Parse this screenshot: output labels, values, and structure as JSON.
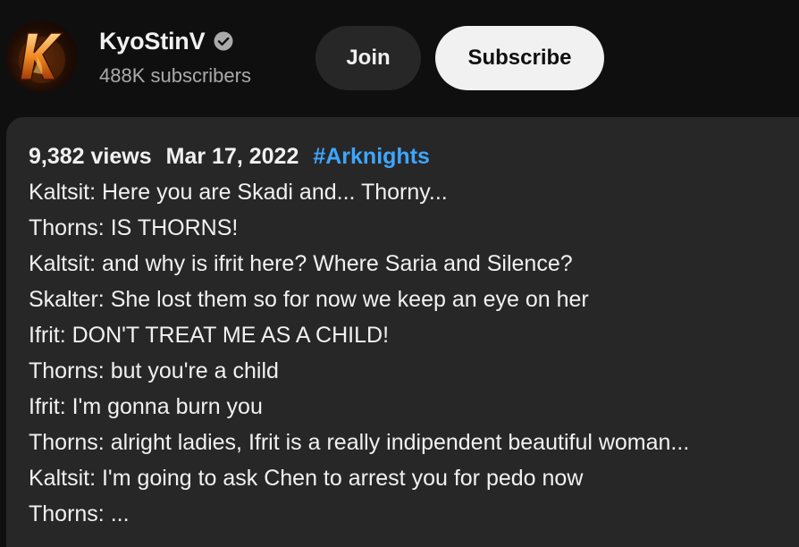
{
  "channel": {
    "avatar_icon": "k-flame-logo-icon",
    "name": "KyoStinV",
    "verified_icon": "verified-check-icon",
    "subscribers": "488K subscribers"
  },
  "buttons": {
    "join_label": "Join",
    "subscribe_label": "Subscribe"
  },
  "description": {
    "views": "9,382 views",
    "date": "Mar 17, 2022",
    "hashtag": "#Arknights",
    "lines": [
      "Kaltsit: Here you are Skadi and... Thorny...",
      "Thorns: IS THORNS!",
      "Kaltsit: and why is ifrit here? Where Saria and Silence?",
      "Skalter: She lost them so for now we keep an eye on her",
      "Ifrit: DON'T TREAT ME AS A CHILD!",
      "Thorns: but you're a child",
      "Ifrit: I'm gonna burn you",
      "Thorns: alright ladies, Ifrit is a really indipendent beautiful woman...",
      "Kaltsit: I'm going to ask Chen to arrest you for pedo now",
      "Thorns: ..."
    ]
  },
  "colors": {
    "background": "#0f0f0f",
    "panel": "#272727",
    "hashtag": "#3ea6ff",
    "subscribe_bg": "#f1f1f1",
    "secondary_text": "#aaaaaa"
  }
}
